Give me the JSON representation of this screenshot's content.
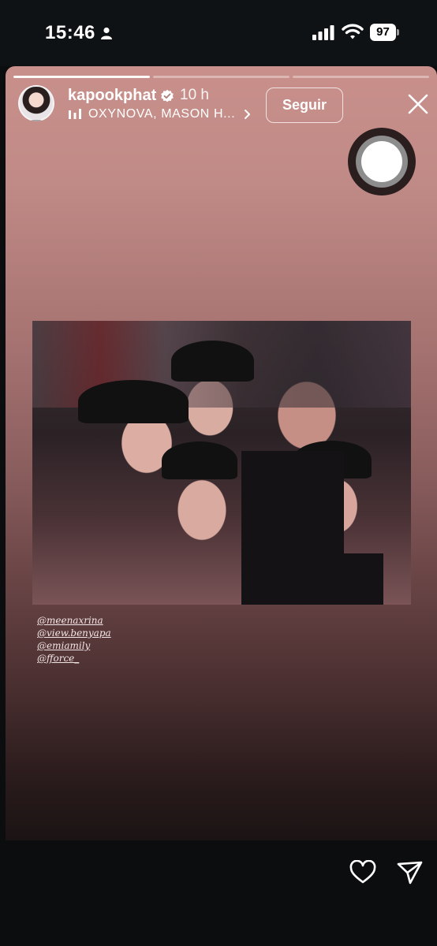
{
  "status_bar": {
    "time": "15:46",
    "battery": "97"
  },
  "story": {
    "progress_segments": 3,
    "active_segment": 1,
    "username": "kapookphat",
    "time_ago": "10 h",
    "music": "OXYNOVA, MASON H...",
    "follow_label": "Seguir",
    "mentions": [
      "@meenaxrina",
      "@view.benyapa",
      "@emiamily",
      "@fforce_"
    ]
  },
  "icons": {
    "person": "person-icon",
    "signal": "signal-icon",
    "wifi": "wifi-icon",
    "verified": "verified-badge-icon",
    "music": "audio-bars-icon",
    "chevron": "chevron-right-icon",
    "close": "close-icon",
    "heart": "heart-icon",
    "send": "send-icon"
  }
}
